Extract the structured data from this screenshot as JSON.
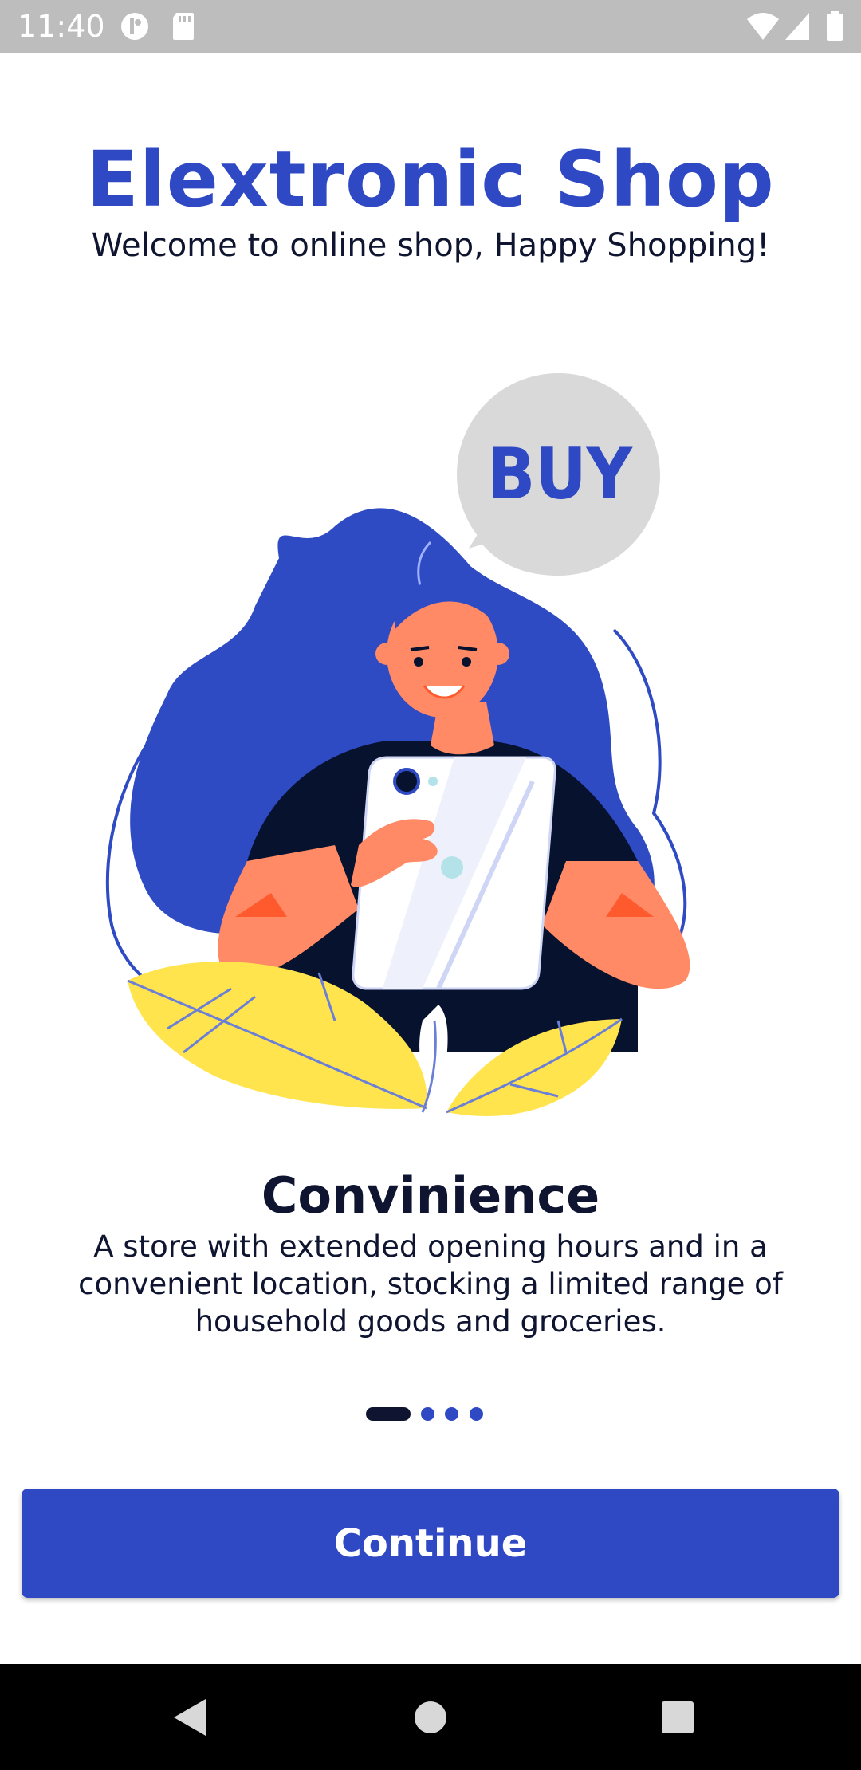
{
  "status_bar": {
    "time": "11:40",
    "icons": [
      "sync-icon",
      "sd-card-icon",
      "wifi-icon",
      "signal-icon",
      "battery-icon"
    ]
  },
  "header": {
    "title": "Elextronic Shop",
    "subtitle": "Welcome to online shop, Happy Shopping!"
  },
  "illustration": {
    "speech_bubble_text": "BUY",
    "colors": {
      "hair": "#2f4bc4",
      "skin": "#ff8a65",
      "shirt": "#06122e",
      "leaves": "#ffe44d",
      "bubble": "#d9d9d9"
    }
  },
  "slide": {
    "title": "Convinience",
    "description": "A store with extended opening hours and in a convenient location, stocking a limited range of household goods and groceries."
  },
  "pager": {
    "total_pages": 4,
    "active_page": 1
  },
  "actions": {
    "continue_label": "Continue"
  },
  "theme": {
    "accent": "#2f49c4",
    "dark_text": "#0f1530",
    "status_bar_bg": "#bdbdbd",
    "nav_bar_bg": "#000000"
  },
  "nav_bar": {
    "buttons": [
      "back-icon",
      "home-icon",
      "recents-icon"
    ]
  }
}
